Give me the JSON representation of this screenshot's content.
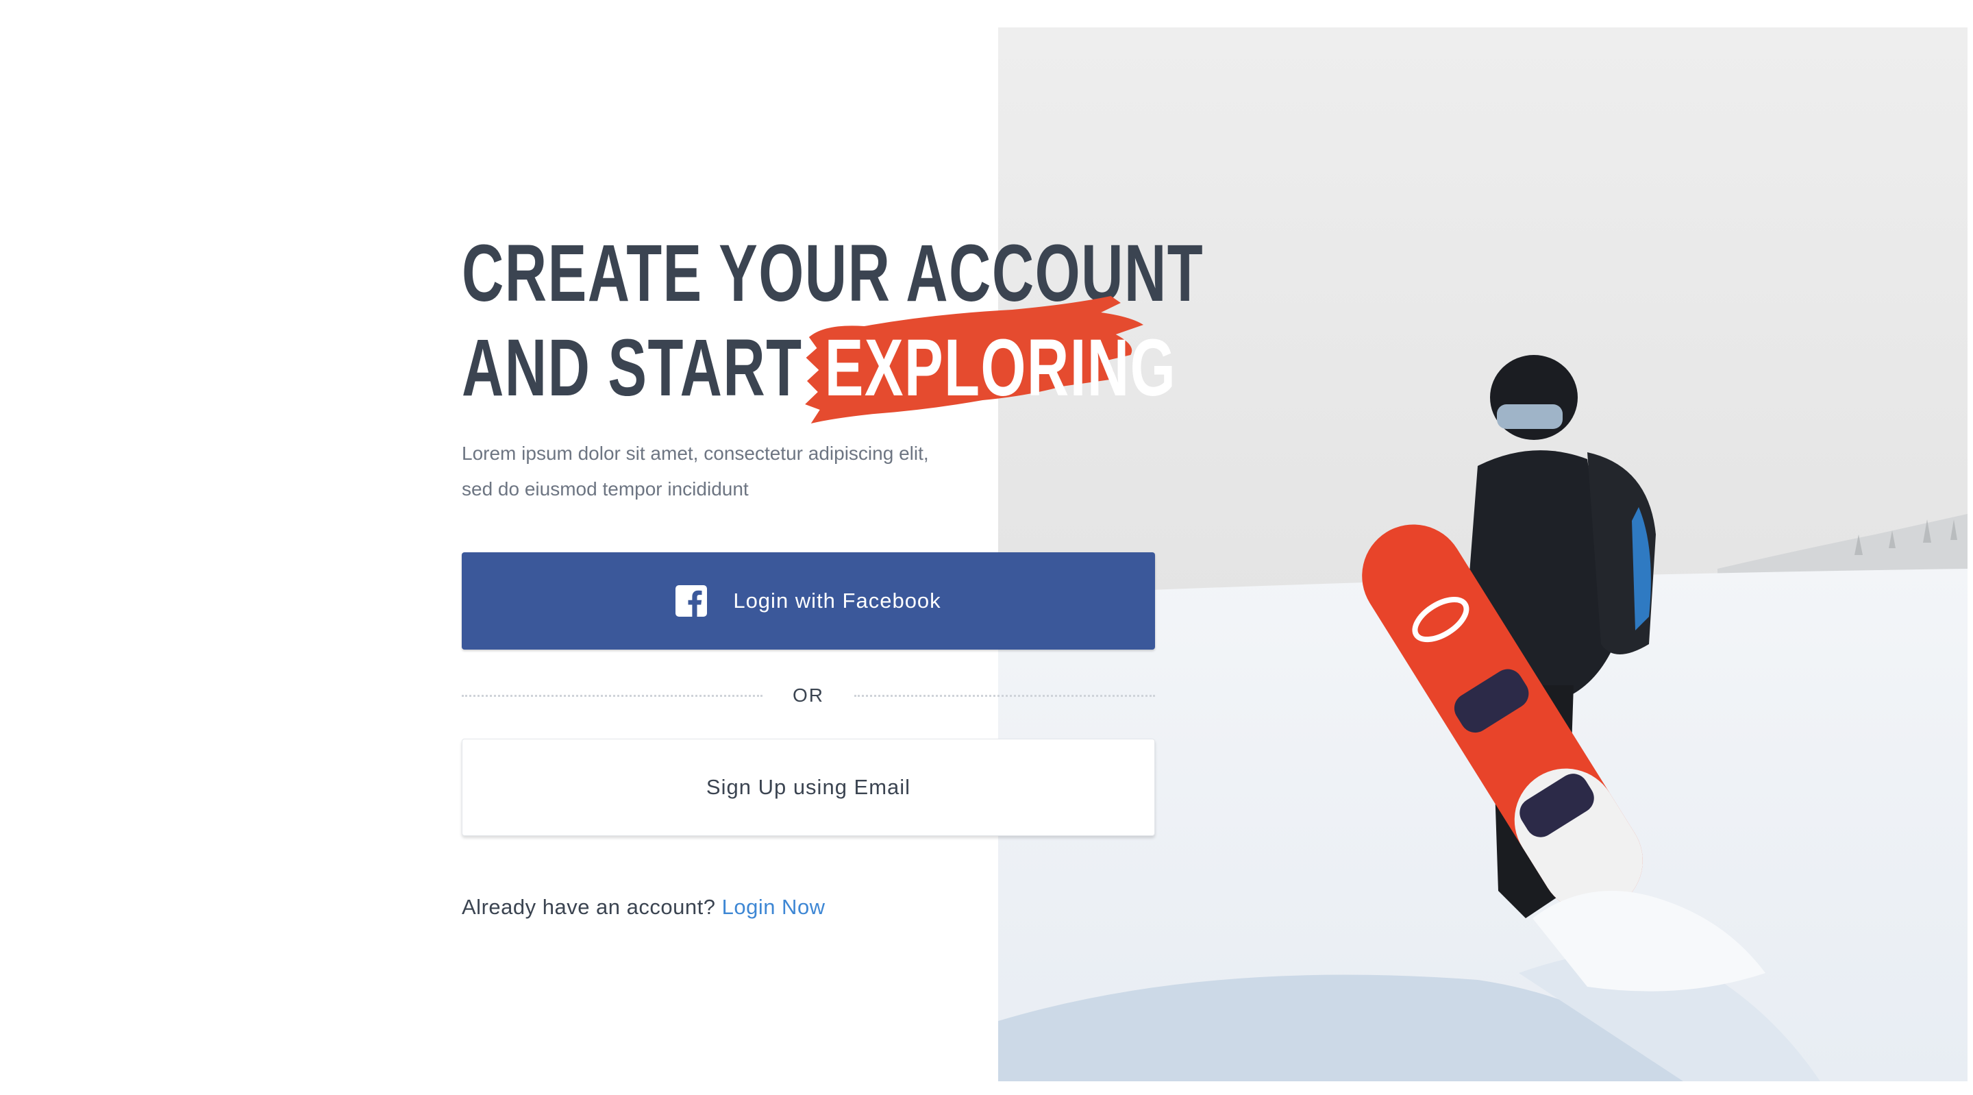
{
  "hero": {
    "title_line1": "CREATE YOUR ACCOUNT",
    "title_line2": "AND START",
    "title_accent": "EXPLORING",
    "description": "Lorem ipsum dolor sit amet, consectetur adipiscing elit, sed do eiusmod tempor incididunt"
  },
  "buttons": {
    "facebook_label": "Login with Facebook",
    "email_label": "Sign Up using Email"
  },
  "divider": {
    "label": "OR"
  },
  "footer": {
    "prompt": "Already have an account?",
    "link_label": "Login Now"
  },
  "icons": {
    "facebook": "facebook-icon",
    "brush": "brush-stroke-decoration"
  },
  "colors": {
    "heading": "#3b4451",
    "accent_brush": "#e54b2f",
    "facebook": "#3b589a",
    "link": "#3e87d4",
    "body_text": "#6d7582"
  }
}
